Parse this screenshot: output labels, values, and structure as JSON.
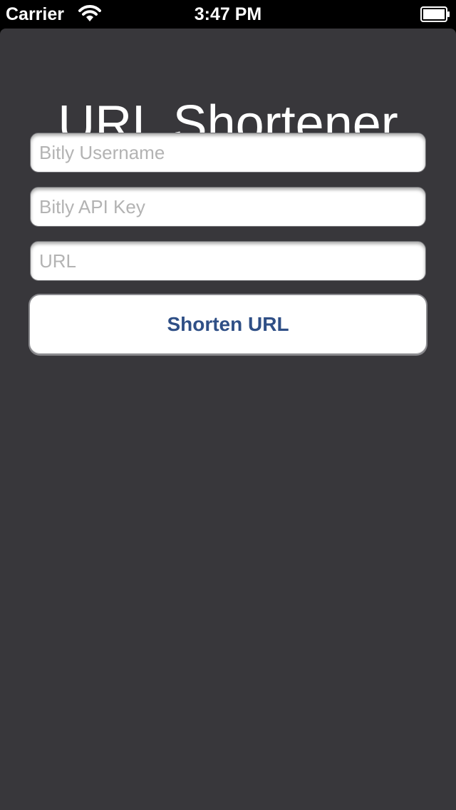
{
  "status_bar": {
    "carrier": "Carrier",
    "time": "3:47 PM",
    "wifi_icon": "wifi-icon",
    "battery_icon": "battery-icon"
  },
  "screen": {
    "title": "URL Shortener",
    "fields": {
      "username": {
        "value": "",
        "placeholder": "Bitly Username"
      },
      "api_key": {
        "value": "",
        "placeholder": "Bitly API Key"
      },
      "url": {
        "value": "",
        "placeholder": "URL"
      }
    },
    "shorten_button_label": "Shorten URL"
  },
  "colors": {
    "status_bar_background": "#000000",
    "screen_background": "#38373b",
    "button_text": "#2f4f86",
    "placeholder_text": "#b3b3b3"
  }
}
